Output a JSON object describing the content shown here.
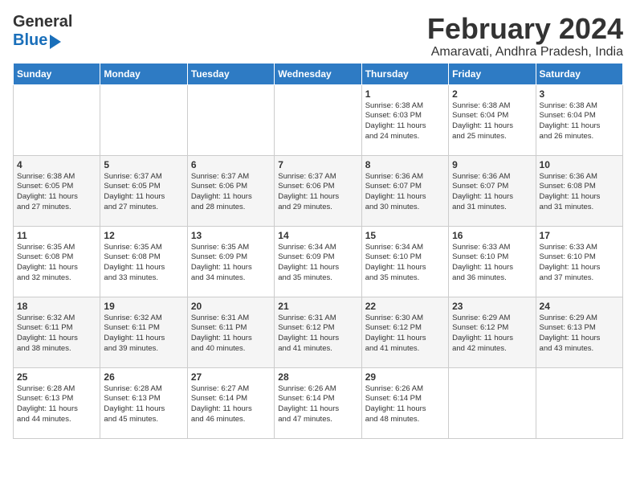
{
  "logo": {
    "general": "General",
    "blue": "Blue"
  },
  "title": "February 2024",
  "subtitle": "Amaravati, Andhra Pradesh, India",
  "headers": [
    "Sunday",
    "Monday",
    "Tuesday",
    "Wednesday",
    "Thursday",
    "Friday",
    "Saturday"
  ],
  "weeks": [
    [
      {
        "day": "",
        "info": ""
      },
      {
        "day": "",
        "info": ""
      },
      {
        "day": "",
        "info": ""
      },
      {
        "day": "",
        "info": ""
      },
      {
        "day": "1",
        "info": "Sunrise: 6:38 AM\nSunset: 6:03 PM\nDaylight: 11 hours\nand 24 minutes."
      },
      {
        "day": "2",
        "info": "Sunrise: 6:38 AM\nSunset: 6:04 PM\nDaylight: 11 hours\nand 25 minutes."
      },
      {
        "day": "3",
        "info": "Sunrise: 6:38 AM\nSunset: 6:04 PM\nDaylight: 11 hours\nand 26 minutes."
      }
    ],
    [
      {
        "day": "4",
        "info": "Sunrise: 6:38 AM\nSunset: 6:05 PM\nDaylight: 11 hours\nand 27 minutes."
      },
      {
        "day": "5",
        "info": "Sunrise: 6:37 AM\nSunset: 6:05 PM\nDaylight: 11 hours\nand 27 minutes."
      },
      {
        "day": "6",
        "info": "Sunrise: 6:37 AM\nSunset: 6:06 PM\nDaylight: 11 hours\nand 28 minutes."
      },
      {
        "day": "7",
        "info": "Sunrise: 6:37 AM\nSunset: 6:06 PM\nDaylight: 11 hours\nand 29 minutes."
      },
      {
        "day": "8",
        "info": "Sunrise: 6:36 AM\nSunset: 6:07 PM\nDaylight: 11 hours\nand 30 minutes."
      },
      {
        "day": "9",
        "info": "Sunrise: 6:36 AM\nSunset: 6:07 PM\nDaylight: 11 hours\nand 31 minutes."
      },
      {
        "day": "10",
        "info": "Sunrise: 6:36 AM\nSunset: 6:08 PM\nDaylight: 11 hours\nand 31 minutes."
      }
    ],
    [
      {
        "day": "11",
        "info": "Sunrise: 6:35 AM\nSunset: 6:08 PM\nDaylight: 11 hours\nand 32 minutes."
      },
      {
        "day": "12",
        "info": "Sunrise: 6:35 AM\nSunset: 6:08 PM\nDaylight: 11 hours\nand 33 minutes."
      },
      {
        "day": "13",
        "info": "Sunrise: 6:35 AM\nSunset: 6:09 PM\nDaylight: 11 hours\nand 34 minutes."
      },
      {
        "day": "14",
        "info": "Sunrise: 6:34 AM\nSunset: 6:09 PM\nDaylight: 11 hours\nand 35 minutes."
      },
      {
        "day": "15",
        "info": "Sunrise: 6:34 AM\nSunset: 6:10 PM\nDaylight: 11 hours\nand 35 minutes."
      },
      {
        "day": "16",
        "info": "Sunrise: 6:33 AM\nSunset: 6:10 PM\nDaylight: 11 hours\nand 36 minutes."
      },
      {
        "day": "17",
        "info": "Sunrise: 6:33 AM\nSunset: 6:10 PM\nDaylight: 11 hours\nand 37 minutes."
      }
    ],
    [
      {
        "day": "18",
        "info": "Sunrise: 6:32 AM\nSunset: 6:11 PM\nDaylight: 11 hours\nand 38 minutes."
      },
      {
        "day": "19",
        "info": "Sunrise: 6:32 AM\nSunset: 6:11 PM\nDaylight: 11 hours\nand 39 minutes."
      },
      {
        "day": "20",
        "info": "Sunrise: 6:31 AM\nSunset: 6:11 PM\nDaylight: 11 hours\nand 40 minutes."
      },
      {
        "day": "21",
        "info": "Sunrise: 6:31 AM\nSunset: 6:12 PM\nDaylight: 11 hours\nand 41 minutes."
      },
      {
        "day": "22",
        "info": "Sunrise: 6:30 AM\nSunset: 6:12 PM\nDaylight: 11 hours\nand 41 minutes."
      },
      {
        "day": "23",
        "info": "Sunrise: 6:29 AM\nSunset: 6:12 PM\nDaylight: 11 hours\nand 42 minutes."
      },
      {
        "day": "24",
        "info": "Sunrise: 6:29 AM\nSunset: 6:13 PM\nDaylight: 11 hours\nand 43 minutes."
      }
    ],
    [
      {
        "day": "25",
        "info": "Sunrise: 6:28 AM\nSunset: 6:13 PM\nDaylight: 11 hours\nand 44 minutes."
      },
      {
        "day": "26",
        "info": "Sunrise: 6:28 AM\nSunset: 6:13 PM\nDaylight: 11 hours\nand 45 minutes."
      },
      {
        "day": "27",
        "info": "Sunrise: 6:27 AM\nSunset: 6:14 PM\nDaylight: 11 hours\nand 46 minutes."
      },
      {
        "day": "28",
        "info": "Sunrise: 6:26 AM\nSunset: 6:14 PM\nDaylight: 11 hours\nand 47 minutes."
      },
      {
        "day": "29",
        "info": "Sunrise: 6:26 AM\nSunset: 6:14 PM\nDaylight: 11 hours\nand 48 minutes."
      },
      {
        "day": "",
        "info": ""
      },
      {
        "day": "",
        "info": ""
      }
    ]
  ]
}
